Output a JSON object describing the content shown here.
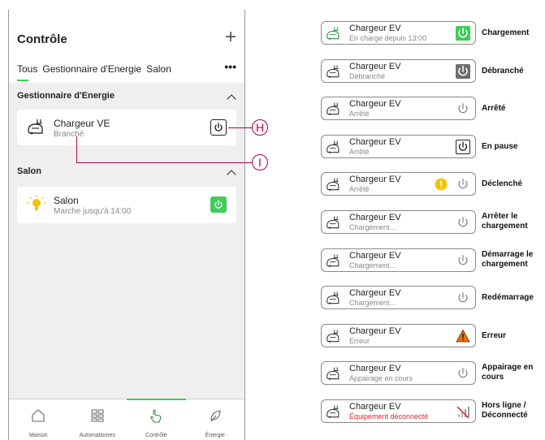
{
  "left": {
    "title": "Contrôle",
    "tabs": [
      "Tous",
      "Gestionnaire d'Energie",
      "Salon"
    ],
    "more": "•••",
    "sections": [
      {
        "title": "Gestionnaire d'Energie",
        "card": {
          "name": "Chargeur VE",
          "status": "Branché",
          "icon": "ev-charger-icon",
          "button": "power-outline-icon"
        }
      },
      {
        "title": "Salon",
        "card": {
          "name": "Salon",
          "status": "Marche jusqu'à 14:00",
          "icon": "light-bulb-icon",
          "button": "power-green-icon"
        }
      }
    ],
    "callouts": [
      "H",
      "I"
    ],
    "nav": [
      "Maison",
      "Automatismes",
      "Contrôle",
      "Énergie"
    ],
    "active_nav": "Contrôle"
  },
  "rows": [
    {
      "name": "Chargeur EV",
      "sub": "En charge depuis 13:00",
      "status_icon": "power-green-icon",
      "label": "Chargement"
    },
    {
      "name": "Chargeur EV",
      "sub": "Débranché",
      "status_icon": "power-grey-icon",
      "label": "Débranché"
    },
    {
      "name": "Chargeur EV",
      "sub": "Arrêté",
      "status_icon": "power-plain-icon",
      "label": "Arrêté"
    },
    {
      "name": "Chargeur EV",
      "sub": "Arrêté",
      "status_icon": "power-outline-icon",
      "label": "En pause"
    },
    {
      "name": "Chargeur EV",
      "sub": "Arrêté",
      "status_icon": "warning-dot-power-icon",
      "label": "Déclenché"
    },
    {
      "name": "Chargeur EV",
      "sub": "Chargement…",
      "status_icon": "power-plain-icon",
      "label": "Arrêter le chargement"
    },
    {
      "name": "Chargeur EV",
      "sub": "Chargement…",
      "status_icon": "power-plain-icon",
      "label": "Démarrage le chargement"
    },
    {
      "name": "Chargeur EV",
      "sub": "Chargement…",
      "status_icon": "power-plain-icon",
      "label": "Redémarrage"
    },
    {
      "name": "Chargeur EV",
      "sub": "Erreur",
      "status_icon": "warning-triangle-icon",
      "label": "Erreur"
    },
    {
      "name": "Chargeur EV",
      "sub": "Appairage en cours",
      "status_icon": "power-plain-icon",
      "label": "Appairage en cours"
    },
    {
      "name": "Chargeur EV",
      "sub": "Équipement déconnecté",
      "status_icon": "signal-off-icon",
      "label": "Hors ligne / Déconnecté"
    }
  ],
  "colors": {
    "accent": "#3dcd58",
    "grey": "#6e6e6e",
    "warning": "#f5c400",
    "error_triangle": "#e8730c",
    "error_text": "#e0202a",
    "callout": "#b0004a"
  }
}
